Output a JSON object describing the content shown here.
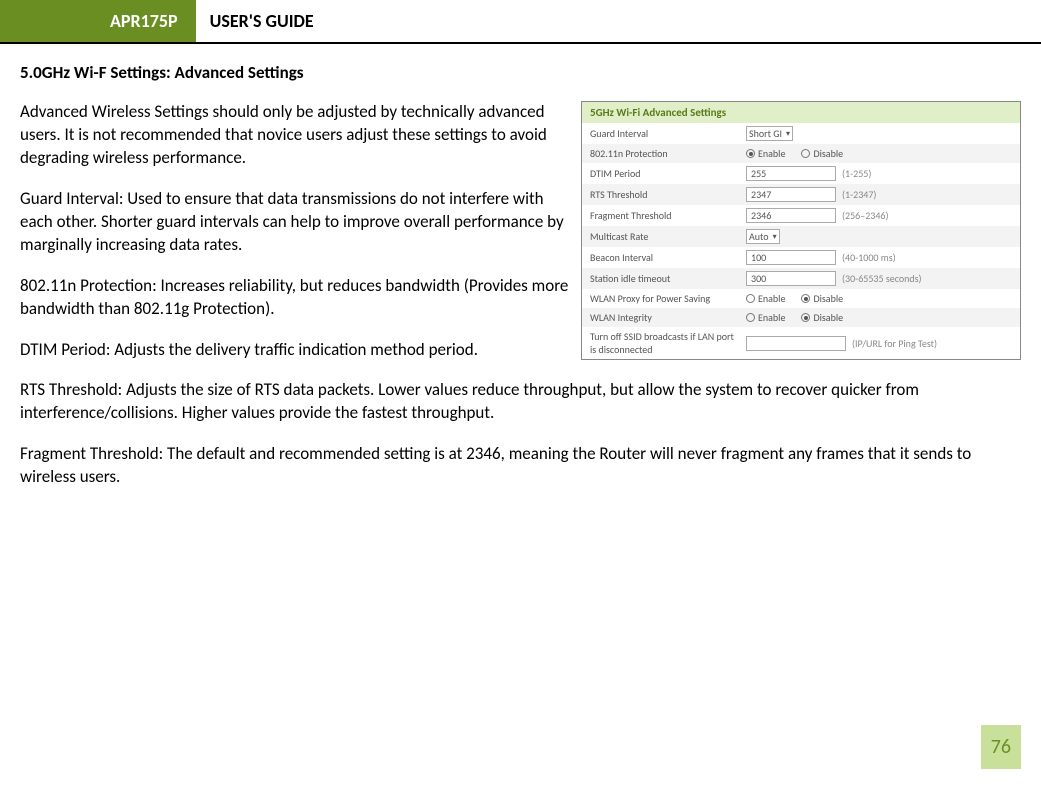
{
  "header": {
    "model": "APR175P",
    "guide": "USER'S GUIDE"
  },
  "section_title": "5.0GHz Wi-F Settings: Advanced Settings",
  "panel": {
    "title": "5GHz Wi-Fi Advanced Settings",
    "guard_interval": {
      "label": "Guard Interval",
      "value": "Short GI"
    },
    "protection": {
      "label": "802.11n Protection",
      "enable": "Enable",
      "disable": "Disable"
    },
    "dtim": {
      "label": "DTIM Period",
      "value": "255",
      "hint": "(1-255)"
    },
    "rts": {
      "label": "RTS Threshold",
      "value": "2347",
      "hint": "(1-2347)"
    },
    "frag": {
      "label": "Fragment Threshold",
      "value": "2346",
      "hint": "(256–2346)"
    },
    "multicast": {
      "label": "Multicast Rate",
      "value": "Auto"
    },
    "beacon": {
      "label": "Beacon Interval",
      "value": "100",
      "hint": "(40-1000 ms)"
    },
    "station": {
      "label": "Station idle timeout",
      "value": "300",
      "hint": "(30-65535 seconds)"
    },
    "wlan_proxy": {
      "label": "WLAN Proxy for Power Saving",
      "enable": "Enable",
      "disable": "Disable"
    },
    "wlan_integrity": {
      "label": "WLAN Integrity",
      "enable": "Enable",
      "disable": "Disable"
    },
    "turnoff": {
      "label": "Turn off SSID broadcasts if LAN port is disconnected",
      "ip": "",
      "hint": "(IP/URL for Ping Test)"
    }
  },
  "paragraphs": {
    "p1": "Advanced Wireless Settings should only be adjusted by technically advanced users. It is not recommended that novice users adjust these settings to avoid degrading wireless performance.",
    "p2": "Guard Interval: Used to ensure that data transmissions do not interfere with each other.  Shorter guard intervals can help to improve overall performance by marginally increasing data rates.",
    "p3": "802.11n Protection: Increases reliability, but reduces bandwidth (Provides more bandwidth than 802.11g Protection).",
    "p4": "DTIM Period: Adjusts the delivery traffic indication method period.",
    "p5": "RTS Threshold: Adjusts the size of RTS data packets. Lower values reduce throughput, but allow the system to recover quicker from interference/collisions. Higher values provide the fastest throughput.",
    "p6": "Fragment Threshold: The default and recommended setting is at 2346, meaning the Router will never fragment any frames that it sends to wireless users."
  },
  "page_number": "76"
}
